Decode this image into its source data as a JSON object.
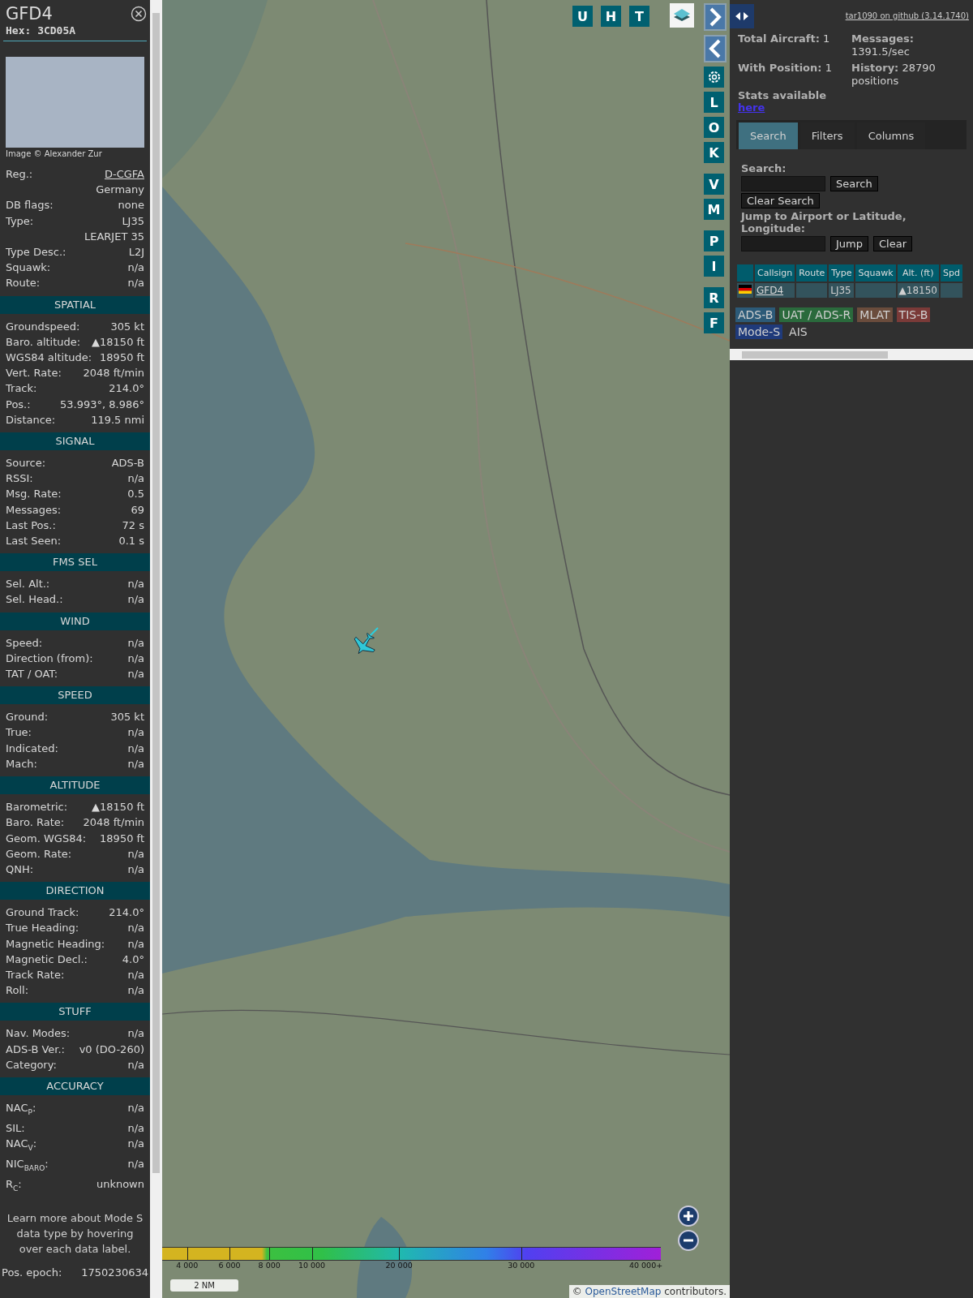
{
  "aircraft_panel": {
    "callsign": "GFD4",
    "hex": "Hex: 3CD05A",
    "photo_credit": "Image © Alexander Zur",
    "details": [
      {
        "label": "Reg.:",
        "value": "D-CGFA",
        "kind": "link"
      },
      {
        "value": "Germany",
        "kind": "plain"
      },
      {
        "label": "DB flags:",
        "value": "none",
        "kind": "plain"
      },
      {
        "label": "Type:",
        "value": "LJ35",
        "kind": "plain"
      },
      {
        "value": "LEARJET 35",
        "kind": "plain"
      },
      {
        "label": "Type Desc.:",
        "value": "L2J",
        "kind": "plain"
      },
      {
        "label": "Squawk:",
        "value": "n/a",
        "kind": "plain"
      },
      {
        "label": "Route:",
        "value": "n/a",
        "kind": "plain"
      }
    ],
    "sections": [
      {
        "title": "SPATIAL",
        "rows": [
          {
            "label": "Groundspeed:",
            "value": "305 kt"
          },
          {
            "label": "Baro. altitude:",
            "value": "▲18150 ft"
          },
          {
            "label": "WGS84 altitude:",
            "value": "18950 ft"
          },
          {
            "label": "Vert. Rate:",
            "value": "2048 ft/min"
          },
          {
            "label": "Track:",
            "value": "214.0°"
          },
          {
            "label": "Pos.:",
            "value": "53.993°, 8.986°"
          },
          {
            "label": "Distance:",
            "value": "119.5 nmi"
          }
        ]
      },
      {
        "title": "SIGNAL",
        "rows": [
          {
            "label": "Source:",
            "value": "ADS-B"
          },
          {
            "label": "RSSI:",
            "value": "n/a"
          },
          {
            "label": "Msg. Rate:",
            "value": "0.5"
          },
          {
            "label": "Messages:",
            "value": "69"
          },
          {
            "label": "Last Pos.:",
            "value": "72 s"
          },
          {
            "label": "Last Seen:",
            "value": "0.1 s"
          }
        ]
      },
      {
        "title": "FMS SEL",
        "rows": [
          {
            "label": "Sel. Alt.:",
            "value": "n/a"
          },
          {
            "label": "Sel. Head.:",
            "value": "n/a"
          }
        ]
      },
      {
        "title": "WIND",
        "rows": [
          {
            "label": "Speed:",
            "value": "n/a"
          },
          {
            "label": "Direction (from):",
            "value": "n/a"
          },
          {
            "label": "TAT / OAT:",
            "value": "n/a"
          }
        ]
      },
      {
        "title": "SPEED",
        "rows": [
          {
            "label": "Ground:",
            "value": "305 kt"
          },
          {
            "label": "True:",
            "value": "n/a"
          },
          {
            "label": "Indicated:",
            "value": "n/a"
          },
          {
            "label": "Mach:",
            "value": "n/a"
          }
        ]
      },
      {
        "title": "ALTITUDE",
        "rows": [
          {
            "label": "Barometric:",
            "value": "▲18150 ft"
          },
          {
            "label": "Baro. Rate:",
            "value": "2048 ft/min"
          },
          {
            "label": "Geom. WGS84:",
            "value": "18950 ft"
          },
          {
            "label": "Geom. Rate:",
            "value": "n/a"
          },
          {
            "label": "QNH:",
            "value": "n/a"
          }
        ]
      },
      {
        "title": "DIRECTION",
        "rows": [
          {
            "label": "Ground Track:",
            "value": "214.0°"
          },
          {
            "label": "True Heading:",
            "value": "n/a"
          },
          {
            "label": "Magnetic Heading:",
            "value": "n/a"
          },
          {
            "label": "Magnetic Decl.:",
            "value": "4.0°"
          },
          {
            "label": "Track Rate:",
            "value": "n/a"
          },
          {
            "label": "Roll:",
            "value": "n/a"
          }
        ]
      },
      {
        "title": "STUFF",
        "rows": [
          {
            "label": "Nav. Modes:",
            "value": "n/a"
          },
          {
            "label": "ADS-B Ver.:",
            "value": "v0 (DO-260)"
          },
          {
            "label": "Category:",
            "value": "n/a"
          }
        ]
      },
      {
        "title": "ACCURACY",
        "rows": [
          {
            "label": "NAC$_{P}$:",
            "value": "n/a"
          },
          {
            "label": "SIL:",
            "value": "n/a"
          },
          {
            "label": "NAC$_{V}$:",
            "value": "n/a"
          },
          {
            "label": "NIC$_{BARO}$:",
            "value": "n/a"
          },
          {
            "label": "R$_{C}$:",
            "value": "unknown"
          }
        ]
      }
    ],
    "note": "Learn more about Mode S data type by hovering over each data label.",
    "epoch": {
      "label": "Pos. epoch:",
      "value": "1750230634"
    }
  },
  "map": {
    "top_buttons": [
      "U",
      "H",
      "T"
    ],
    "side_groups": [
      [
        "L",
        "O",
        "K"
      ],
      [
        "V",
        "M"
      ],
      [
        "P",
        "I"
      ],
      [
        "R",
        "F"
      ]
    ],
    "altitude_legend": [
      "4 000",
      "6 000",
      "8 000",
      "10 000",
      "20 000",
      "30 000",
      "40 000+"
    ],
    "scale": "2 NM",
    "attribution": {
      "prefix": "©",
      "link": "OpenStreetMap",
      "suffix": "contributors."
    }
  },
  "info_panel": {
    "github_link": "tar1090 on github (3.14.1740)",
    "stats": [
      {
        "label": "Total Aircraft:",
        "value": "1"
      },
      {
        "label": "Messages:",
        "value": "1391.5/sec"
      },
      {
        "label": "With Position:",
        "value": "1"
      },
      {
        "label": "History:",
        "value": "28790 positions"
      }
    ],
    "stats_text": "Stats available",
    "stats_link": "here",
    "tabs": [
      {
        "label": "Search",
        "selected": true
      },
      {
        "label": "Filters",
        "selected": false
      },
      {
        "label": "Columns",
        "selected": false
      }
    ],
    "search_label": "Search:",
    "search_button": "Search",
    "clear_search_button": "Clear Search",
    "jump_label": "Jump to Airport or Latitude, Longitude:",
    "jump_button": "Jump",
    "clear_button": "Clear",
    "table": {
      "columns": [
        "Callsign",
        "Route",
        "Type",
        "Squawk",
        "Alt. (ft)",
        "Spd"
      ],
      "rows": [
        {
          "cells": [
            "GFD4",
            null,
            "LJ35",
            null,
            "▲18150",
            null
          ]
        }
      ]
    },
    "sources": [
      {
        "label": "ADS-B",
        "color": "#2c5a78"
      },
      {
        "label": "UAT / ADS-R",
        "color": "#2a6a3c"
      },
      {
        "label": "MLAT",
        "color": "#6a4c3c"
      },
      {
        "label": "TIS-B",
        "color": "#7a3a38"
      },
      {
        "label": "Mode-S",
        "color": "#1f3a7a"
      },
      {
        "label": "AIS"
      }
    ]
  }
}
